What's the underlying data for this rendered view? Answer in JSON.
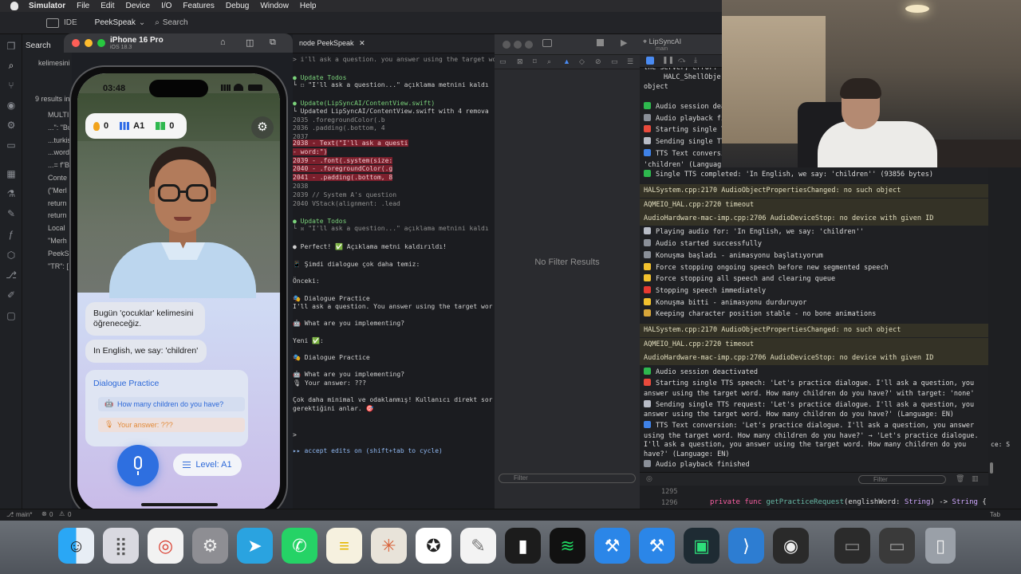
{
  "menubar": {
    "app": "Simulator",
    "items": [
      "File",
      "Edit",
      "Device",
      "I/O",
      "Features",
      "Debug",
      "Window",
      "Help"
    ]
  },
  "ide": {
    "label": "IDE",
    "project": "PeekSpeak",
    "search_placeholder": "Search"
  },
  "explorer": {
    "title": "Search",
    "query": "kelimesini öğreneceğiz",
    "results": "9 results in",
    "rows": [
      "MULTI",
      "...\": \"Bu",
      "...turkis",
      "...word",
      "...= f\"B",
      "Conte",
      "(\"Merl",
      "return",
      "return",
      "Local",
      "\"Merh",
      "PeekS",
      "\"TR\": ["
    ]
  },
  "simulator": {
    "device": "iPhone 16 Pro",
    "os": "iOS 18.3"
  },
  "phone": {
    "time": "03:48",
    "streak": "0",
    "level_badge": "A1",
    "words": "0",
    "chat": [
      "Bugün 'çocuklar' kelimesini öğreneceğiz.",
      "In English, we say: 'children'"
    ],
    "dialogue": {
      "title": "Dialogue Practice",
      "question": "How many children do you have?",
      "answer": "Your answer: ???"
    },
    "level_button": "Level: A1"
  },
  "terminal": {
    "tab": "node PeekSpeak",
    "lines": [
      {
        "t": "> i'll ask a question. you answer using the target wor",
        "c": "dim"
      },
      {
        "t": "● Update Todos",
        "c": "green"
      },
      {
        "t": "  └ ☐ \"I'll ask a question...\" açıklama metnini kaldı",
        "c": ""
      },
      {
        "t": "● Update(LipSyncAI/ContentView.swift)",
        "c": "green"
      },
      {
        "t": "  └ Updated LipSyncAI/ContentView.swift with 4 remova",
        "c": ""
      },
      {
        "t": "    2035                       .foregroundColor(.b",
        "c": "dim"
      },
      {
        "t": "    2036                       .padding(.bottom, 4",
        "c": "dim"
      },
      {
        "t": "    2037",
        "c": "dim"
      },
      {
        "t": "    2038 -                 Text(\"I'll ask a questi",
        "c": "hl"
      },
      {
        "t": "         - word:\")",
        "c": "hl"
      },
      {
        "t": "    2039 -                     .font(.system(size:",
        "c": "hl"
      },
      {
        "t": "    2040 -                     .foregroundColor(.g",
        "c": "hl"
      },
      {
        "t": "    2041 -                     .padding(.bottom, 8",
        "c": "hl"
      },
      {
        "t": "    2038",
        "c": "dim"
      },
      {
        "t": "    2039                  // System A's question",
        "c": "dim"
      },
      {
        "t": "    2040                  VStack(alignment: .lead",
        "c": "dim"
      },
      {
        "t": "● Update Todos",
        "c": "green"
      },
      {
        "t": "  └ ☒ \"I'll ask a question...\" açıklama metnini kaldı",
        "c": "dim"
      },
      {
        "t": "● Perfect! ✅ Açıklama metni kaldırıldı!",
        "c": ""
      },
      {
        "t": "  📱 Şimdi dialogue çok daha temiz:",
        "c": ""
      },
      {
        "t": "  Önceki:",
        "c": ""
      },
      {
        "t": "  🎭 Dialogue Practice",
        "c": ""
      },
      {
        "t": "  I'll ask a question. You answer using the target wor",
        "c": ""
      },
      {
        "t": "  🤖 What are you implementing?",
        "c": ""
      },
      {
        "t": "  Yeni ✅:",
        "c": ""
      },
      {
        "t": "  🎭 Dialogue Practice",
        "c": ""
      },
      {
        "t": "  🤖 What are you implementing?",
        "c": ""
      },
      {
        "t": "  🎙 Your answer: ???",
        "c": ""
      },
      {
        "t": "  Çok daha minimal ve odaklanmış! Kullanıcı direkt sor",
        "c": ""
      },
      {
        "t": "  gerektiğini anlar. 🎯",
        "c": ""
      },
      {
        "t": ">",
        "c": ""
      },
      {
        "t": "  ▸▸ accept edits on (shift+tab to cycle)",
        "c": "blue"
      }
    ]
  },
  "xcode": {
    "scheme": "LipSyncAI",
    "branch": "main",
    "empty": "No Filter Results",
    "filter_placeholder": "Filter"
  },
  "console": {
    "header_lines": [
      "the server, error: ...",
      "HALC_ShellObje",
      "object"
    ],
    "lines": [
      {
        "t": "Audio session dea",
        "e": "ok"
      },
      {
        "t": "Audio playback fi",
        "e": "note"
      },
      {
        "t": "Starting single T",
        "e": "target"
      },
      {
        "t": "Sending single TT",
        "e": "rocket"
      },
      {
        "t": "TTS Text conversi",
        "e": "cycle"
      },
      {
        "t": "'children' (Languag",
        "e": ""
      },
      {
        "t": "Single TTS completed: 'In English, we say: 'children'' (93856 bytes)",
        "e": "ok"
      },
      {
        "t": "        HALSystem.cpp:2170   AudioObjectPropertiesChanged: no such object",
        "e": "sys"
      },
      {
        "t": "        AQMEIO_HAL.cpp:2720   timeout",
        "e": "sys"
      },
      {
        "t": "AudioHardware-mac-imp.cpp:2706   AudioDeviceStop: no device with given ID",
        "e": "sys"
      },
      {
        "t": "Playing audio for: 'In English, we say: 'children''",
        "e": "rocket"
      },
      {
        "t": "Audio started successfully",
        "e": "note"
      },
      {
        "t": "Konuşma başladı - animasyonu başlatıyorum",
        "e": "note"
      },
      {
        "t": "Force stopping ongoing speech before new segmented speech",
        "e": "warn"
      },
      {
        "t": "Force stopping all speech and clearing queue",
        "e": "warn"
      },
      {
        "t": "Stopping speech immediately",
        "e": "stop"
      },
      {
        "t": "Konuşma bitti - animasyonu durduruyor",
        "e": "smile"
      },
      {
        "t": "Keeping character position stable - no bone animations",
        "e": "lock"
      },
      {
        "t": "        HALSystem.cpp:2170   AudioObjectPropertiesChanged: no such object",
        "e": "sys"
      },
      {
        "t": "        AQMEIO_HAL.cpp:2720   timeout",
        "e": "sys"
      },
      {
        "t": "AudioHardware-mac-imp.cpp:2706   AudioDeviceStop: no device with given ID",
        "e": "sys"
      },
      {
        "t": "Audio session deactivated",
        "e": "ok"
      },
      {
        "t": "Starting single TTS speech: 'Let's practice dialogue. I'll ask a question, you",
        "e": "target"
      },
      {
        "t": "answer using the target word. How many children do you have?' with target: 'none'",
        "e": ""
      },
      {
        "t": "Sending single TTS request: 'Let's practice dialogue. I'll ask a question, you",
        "e": "rocket"
      },
      {
        "t": "answer using the target word. How many children do you have?' (Language: EN)",
        "e": ""
      },
      {
        "t": "TTS Text conversion: 'Let's practice dialogue. I'll ask a question, you answer",
        "e": "cycle"
      },
      {
        "t": "using the target word. How many children do you have?' → 'Let's practice dialogue.",
        "e": ""
      },
      {
        "t": "I'll ask a question, you answer using the target word. How many children do you",
        "e": ""
      },
      {
        "t": "have?' (Language: EN)",
        "e": ""
      },
      {
        "t": "Audio playback finished",
        "e": "note"
      }
    ],
    "filter_placeholder": "Filter"
  },
  "editor": {
    "lines": [
      {
        "n": "1295",
        "code": ""
      },
      {
        "n": "1296",
        "kw": "private func ",
        "fn": "getPracticeRequest",
        "rest1": "(englishWord: ",
        "ty": "String",
        "rest2": ") -> ",
        "ty2": "String",
        "rest3": " {"
      }
    ],
    "side_text": "ce: S"
  },
  "statusbar": {
    "branch": "main*",
    "errors": "0",
    "warnings": "0",
    "tab": "Tab"
  },
  "colors": {
    "accent_blue": "#2e6fe0",
    "terminal_removed": "#7b1f2c",
    "console_sys": "#343226"
  },
  "dock": {
    "icons": [
      "finder-icon",
      "launchpad-icon",
      "chrome-icon",
      "system-settings-icon",
      "telegram-icon",
      "whatsapp-icon",
      "notes-icon",
      "claude-icon",
      "chatgpt-icon",
      "textedit-icon",
      "terminal-icon",
      "spotify-icon",
      "xcode-icon",
      "xcode-beta-icon",
      "app-icon",
      "vscode-icon",
      "obs-icon",
      "window-thumb-icon",
      "window-thumb-icon-2",
      "trash-icon"
    ]
  }
}
